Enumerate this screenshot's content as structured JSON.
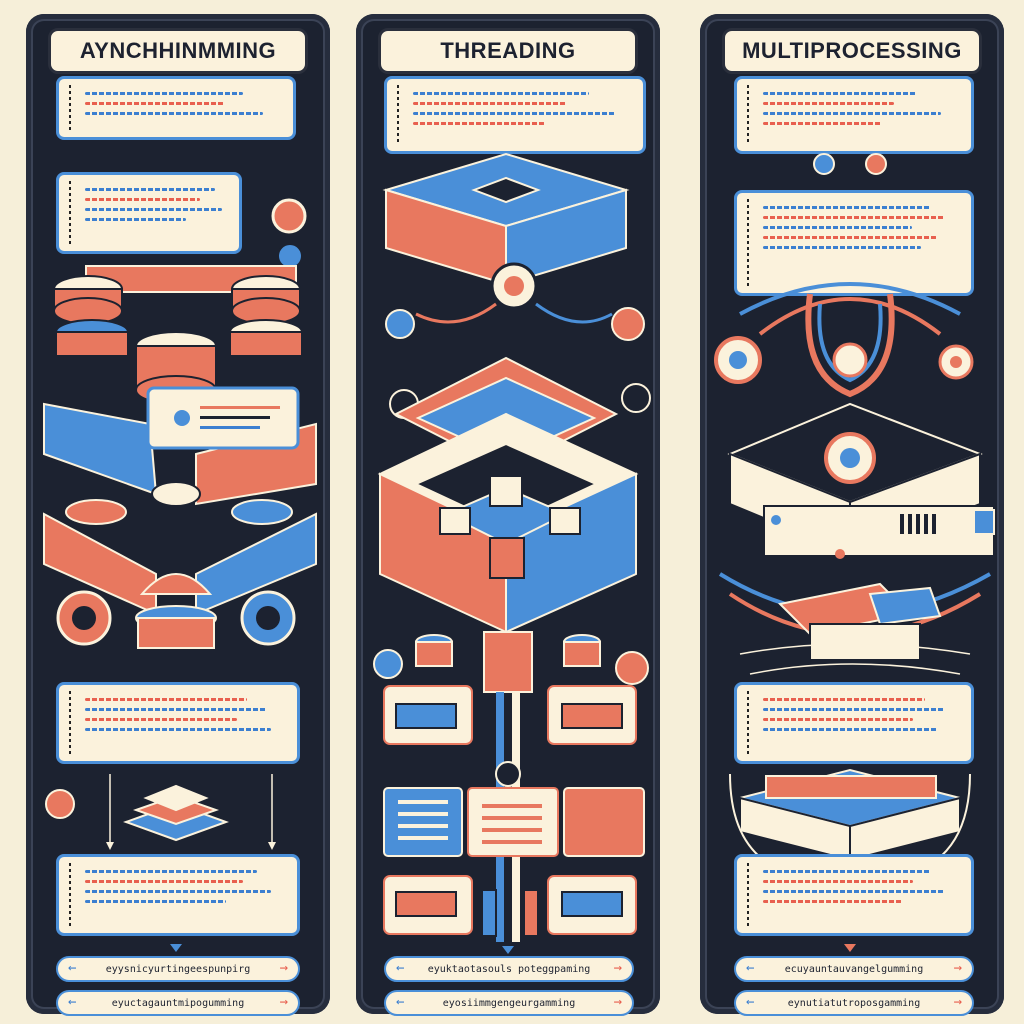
{
  "panels": [
    {
      "title": "AYNCHHINMMING",
      "footer_top": "eyysnicyurtingeespunpirg",
      "footer_bottom": "eyuctagauntmipogumming"
    },
    {
      "title": "THREADING",
      "footer_top": "eyuktaotasouls poteggpaming",
      "footer_bottom": "eyosiimmgengeurgamming"
    },
    {
      "title": "MULTIPROCESSING",
      "footer_top": "ecuyauntauvangelgumming",
      "footer_bottom": "eynutiatutroposgamming"
    }
  ],
  "colors": {
    "background": "#f6efd9",
    "panel": "#1c2230",
    "accent_blue": "#4a8fd8",
    "accent_coral": "#e8785f",
    "cream": "#fbf2dc"
  }
}
